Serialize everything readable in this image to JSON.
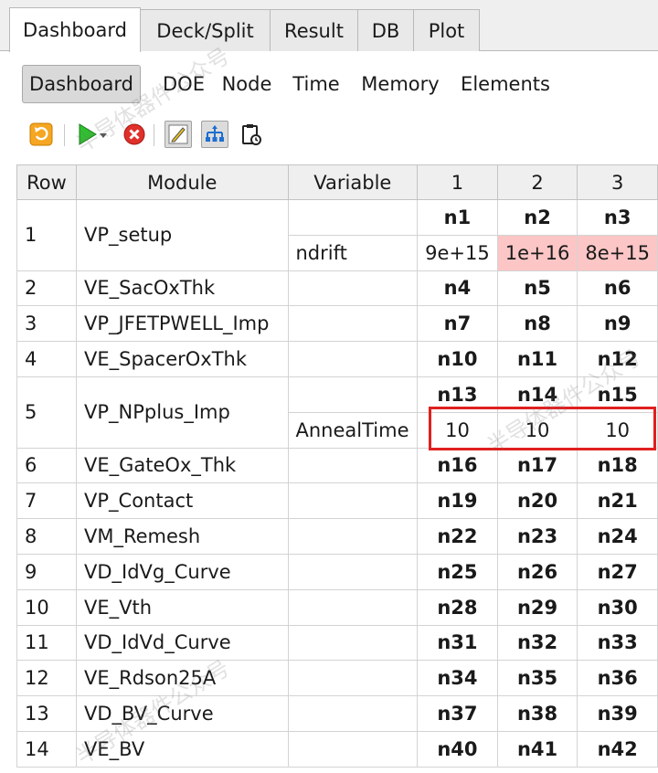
{
  "tabs": [
    {
      "label": "Dashboard",
      "active": true
    },
    {
      "label": "Deck/Split",
      "active": false
    },
    {
      "label": "Result",
      "active": false
    },
    {
      "label": "DB",
      "active": false
    },
    {
      "label": "Plot",
      "active": false
    }
  ],
  "subtabs": [
    {
      "label": "Dashboard",
      "active": true
    },
    {
      "label": "DOE",
      "active": false
    },
    {
      "label": "Node",
      "active": false
    },
    {
      "label": "Time",
      "active": false
    },
    {
      "label": "Memory",
      "active": false
    },
    {
      "label": "Elements",
      "active": false
    }
  ],
  "toolbar": [
    {
      "icon": "refresh-icon"
    },
    {
      "icon": "run-icon"
    },
    {
      "icon": "stop-icon"
    },
    {
      "icon": "edit-icon",
      "toggled": true
    },
    {
      "icon": "tree-icon",
      "toggled": true
    },
    {
      "icon": "clipboard-icon"
    }
  ],
  "table": {
    "headers": [
      "Row",
      "Module",
      "Variable",
      "1",
      "2",
      "3"
    ],
    "rows": [
      {
        "row": "1",
        "module": "VP_setup",
        "sub": [
          {
            "variable": "",
            "cells": [
              "n1",
              "n2",
              "n3"
            ],
            "kind": "node"
          },
          {
            "variable": "ndrift",
            "cells": [
              "9e+15",
              "1e+16",
              "8e+15"
            ],
            "kind": "value",
            "highlight": [
              false,
              true,
              true
            ]
          }
        ]
      },
      {
        "row": "2",
        "module": "VE_SacOxThk",
        "cells": [
          "n4",
          "n5",
          "n6"
        ]
      },
      {
        "row": "3",
        "module": "VP_JFETPWELL_Imp",
        "cells": [
          "n7",
          "n8",
          "n9"
        ]
      },
      {
        "row": "4",
        "module": "VE_SpacerOxThk",
        "cells": [
          "n10",
          "n11",
          "n12"
        ]
      },
      {
        "row": "5",
        "module": "VP_NPplus_Imp",
        "sub": [
          {
            "variable": "",
            "cells": [
              "n13",
              "n14",
              "n15"
            ],
            "kind": "node"
          },
          {
            "variable": "AnnealTime",
            "cells": [
              "10",
              "10",
              "10"
            ],
            "kind": "value",
            "highlight": [
              false,
              false,
              false
            ]
          }
        ]
      },
      {
        "row": "6",
        "module": "VE_GateOx_Thk",
        "cells": [
          "n16",
          "n17",
          "n18"
        ]
      },
      {
        "row": "7",
        "module": "VP_Contact",
        "cells": [
          "n19",
          "n20",
          "n21"
        ]
      },
      {
        "row": "8",
        "module": "VM_Remesh",
        "cells": [
          "n22",
          "n23",
          "n24"
        ]
      },
      {
        "row": "9",
        "module": "VD_IdVg_Curve",
        "cells": [
          "n25",
          "n26",
          "n27"
        ]
      },
      {
        "row": "10",
        "module": "VE_Vth",
        "cells": [
          "n28",
          "n29",
          "n30"
        ]
      },
      {
        "row": "11",
        "module": "VD_IdVd_Curve",
        "cells": [
          "n31",
          "n32",
          "n33"
        ]
      },
      {
        "row": "12",
        "module": "VE_Rdson25A",
        "cells": [
          "n34",
          "n35",
          "n36"
        ]
      },
      {
        "row": "13",
        "module": "VD_BV_Curve",
        "cells": [
          "n37",
          "n38",
          "n39"
        ]
      },
      {
        "row": "14",
        "module": "VE_BV",
        "cells": [
          "n40",
          "n41",
          "n42"
        ]
      }
    ]
  },
  "colors": {
    "node_green": "#00ff00",
    "value_pink": "#fcc6c6",
    "highlight_red": "#e02020"
  },
  "watermark": "半导体器件公众号"
}
